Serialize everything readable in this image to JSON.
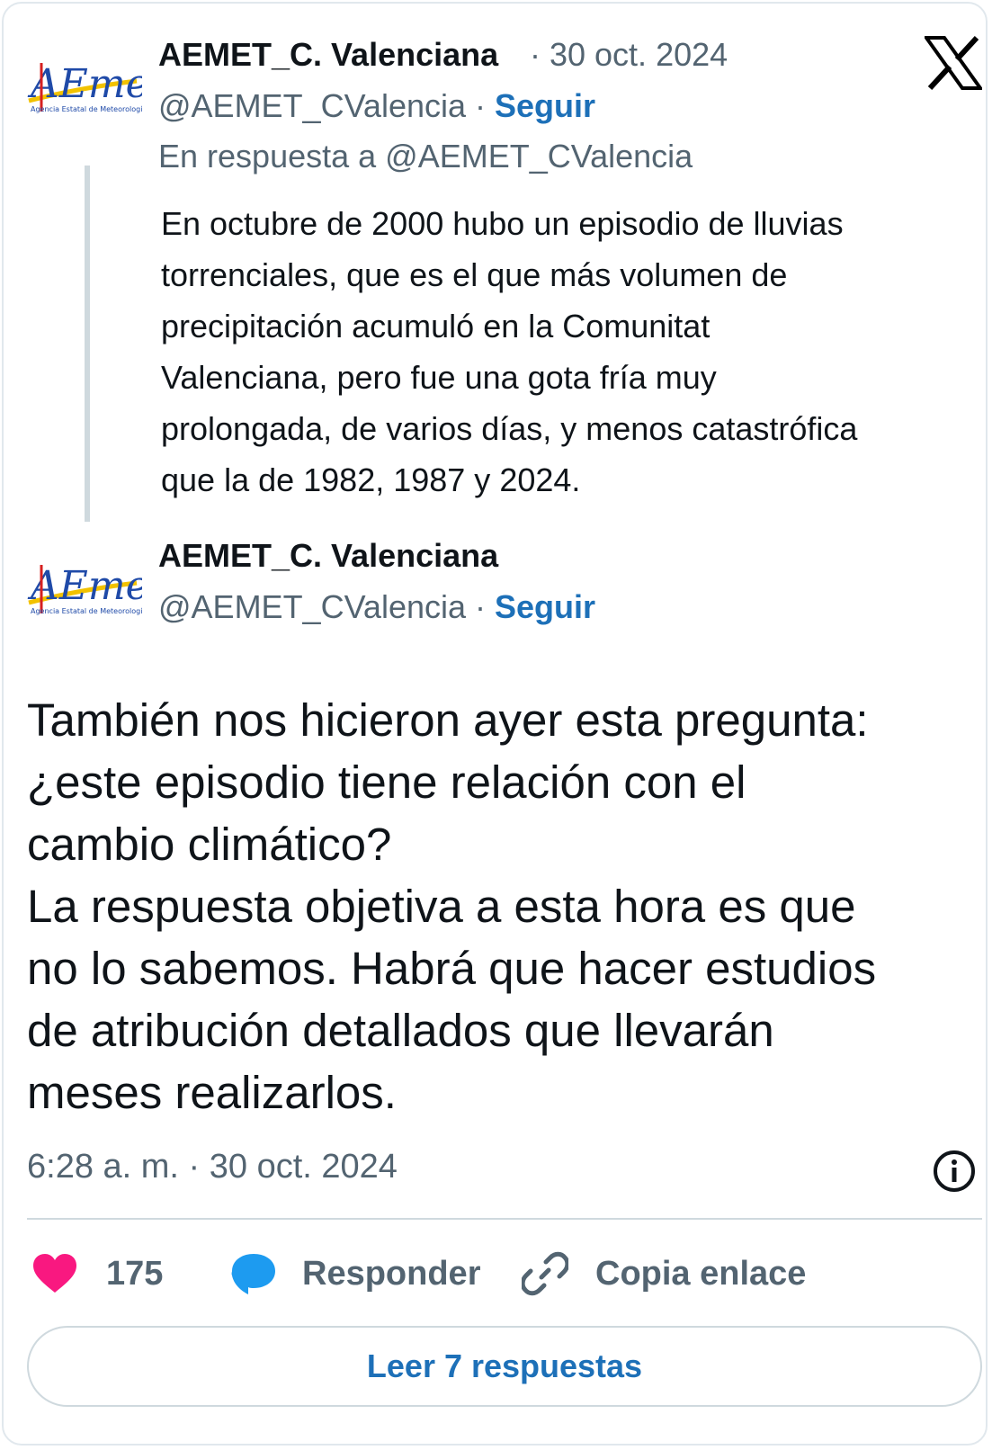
{
  "parent_tweet": {
    "author_name": "AEMET_C. Valenciana",
    "date": "· 30 oct. 2024",
    "handle": "@AEMET_CValencia",
    "separator": " · ",
    "follow_label": "Seguir",
    "reply_to": "En respuesta a @AEMET_CValencia",
    "text_lines": [
      "En octubre de 2000 hubo un episodio de lluvias",
      "torrenciales, que es el que más volumen de",
      "precipitación acumuló en la Comunitat",
      "Valenciana, pero fue una gota fría muy",
      "prolongada, de varios días, y menos catastrófica",
      "que la de 1982, 1987 y 2024."
    ]
  },
  "main_tweet": {
    "author_name": "AEMET_C. Valenciana",
    "handle": "@AEMET_CValencia",
    "separator": " · ",
    "follow_label": "Seguir",
    "text_lines": [
      "También nos hicieron ayer esta pregunta:",
      "¿este episodio tiene relación con el",
      "cambio climático?",
      "La respuesta objetiva a esta hora es que",
      "no lo sabemos. Habrá que hacer estudios",
      "de atribución detallados que llevarán",
      "meses realizarlos."
    ],
    "timestamp": "6:28 a. m. · 30 oct. 2024"
  },
  "logo": {
    "wordmark": "AEmet",
    "tagline": "Agencia Estatal de Meteorología"
  },
  "actions": {
    "like_count": "175",
    "reply_label": "Responder",
    "copy_link_label": "Copia enlace"
  },
  "read_replies_label": "Leer 7 respuestas",
  "icons": {
    "x_logo": "x-logo-icon",
    "info": "info-icon",
    "heart": "heart-icon",
    "reply": "speech-bubble-icon",
    "link": "link-icon"
  },
  "colors": {
    "heart": "#f91880",
    "reply_bubble": "#1d9bf0",
    "follow_link": "#1d70b8",
    "muted_text": "#536471"
  }
}
